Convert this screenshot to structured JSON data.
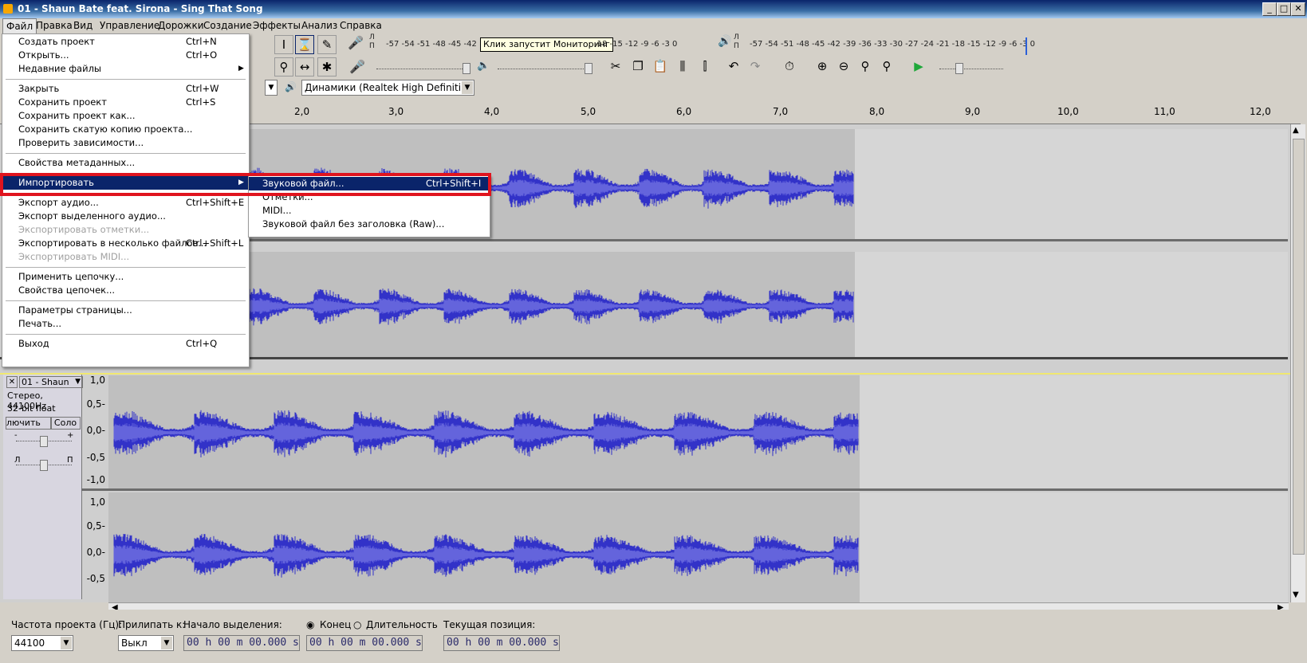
{
  "window": {
    "title": "01 - Shaun Bate feat. Sirona - Sing That Song",
    "minimize": "_",
    "maximize": "□",
    "close": "✕"
  },
  "menubar": [
    "Файл",
    "Правка",
    "Вид",
    "Управление",
    "Дорожки",
    "Создание",
    "Эффекты",
    "Анализ",
    "Справка"
  ],
  "meters": {
    "record_label_l": "Л",
    "record_label_r": "П",
    "record_scale": "-57 -54 -51 -48 -45 -42",
    "record_tooltip": "Клик запустит Мониторинг",
    "record_scale_right": "-18 -15 -12  -9  -6  -3  0",
    "play_label_l": "Л",
    "play_label_r": "П",
    "play_scale": "-57 -54 -51 -48 -45 -42 -39 -36 -33 -30 -27 -24 -21 -18 -15 -12  -9  -6  -3  0"
  },
  "device": {
    "output": "Динамики (Realtek High Definiti"
  },
  "ruler": [
    "2,0",
    "3,0",
    "4,0",
    "5,0",
    "6,0",
    "7,0",
    "8,0",
    "9,0",
    "10,0",
    "11,0",
    "12,0"
  ],
  "track2": {
    "name": "01 - Shaun",
    "close": "✕",
    "info1": "Стерео, 44100Hz",
    "info2": "32-bit float",
    "mute": "лючить зву",
    "solo": "Соло",
    "gain_minus": "-",
    "gain_plus": "+",
    "pan_l": "Л",
    "pan_r": "П"
  },
  "vscale_top": [
    "1,0",
    "0,5-",
    "0,0-",
    "-0,5",
    "-1,0"
  ],
  "vscale_bottom": [
    "1,0",
    "0,5-",
    "0,0-",
    "-0,5"
  ],
  "file_menu": {
    "items": [
      {
        "label": "Создать проект",
        "shortcut": "Ctrl+N"
      },
      {
        "label": "Открыть...",
        "shortcut": "Ctrl+O"
      },
      {
        "label": "Недавние файлы",
        "shortcut": ""
      },
      {
        "label": "Закрыть",
        "shortcut": "Ctrl+W"
      },
      {
        "label": "Сохранить проект",
        "shortcut": "Ctrl+S"
      },
      {
        "label": "Сохранить проект как...",
        "shortcut": ""
      },
      {
        "label": "Сохранить скатую копию проекта...",
        "shortcut": ""
      },
      {
        "label": "Проверить зависимости...",
        "shortcut": ""
      },
      {
        "label": "Свойства метаданных...",
        "shortcut": ""
      },
      {
        "label": "Импортировать",
        "shortcut": ""
      },
      {
        "label": "Экспорт аудио...",
        "shortcut": "Ctrl+Shift+E"
      },
      {
        "label": "Экспорт выделенного аудио...",
        "shortcut": ""
      },
      {
        "label": "Экспортировать отметки...",
        "shortcut": ""
      },
      {
        "label": "Экспортировать в несколько файлов...",
        "shortcut": "Ctrl+Shift+L"
      },
      {
        "label": "Экспортировать MIDI...",
        "shortcut": ""
      },
      {
        "label": "Применить цепочку...",
        "shortcut": ""
      },
      {
        "label": "Свойства цепочек...",
        "shortcut": ""
      },
      {
        "label": "Параметры страницы...",
        "shortcut": ""
      },
      {
        "label": "Печать...",
        "shortcut": ""
      },
      {
        "label": "Выход",
        "shortcut": "Ctrl+Q"
      }
    ]
  },
  "import_submenu": {
    "items": [
      {
        "label": "Звуковой файл...",
        "shortcut": "Ctrl+Shift+I"
      },
      {
        "label": "Отметки...",
        "shortcut": ""
      },
      {
        "label": "MIDI...",
        "shortcut": ""
      },
      {
        "label": "Звуковой файл без заголовка (Raw)...",
        "shortcut": ""
      }
    ]
  },
  "selection_bar": {
    "rate_label": "Частота проекта (Гц):",
    "rate_value": "44100",
    "snap_label": "Прилипать к:",
    "snap_value": "Выкл",
    "start_label": "Начало выделения:",
    "end_radio": "Конец",
    "length_radio": "Длительность",
    "pos_label": "Текущая позиция:",
    "start_time": "00 h 00 m 00.000 s",
    "end_time": "00 h 00 m 00.000 s",
    "pos_time": "00 h 00 m 00.000 s"
  },
  "colors": {
    "wave": "#3232c8",
    "wave_light": "#6464dc",
    "highlight": "#e0141e",
    "menu_hl": "#0a246a"
  }
}
